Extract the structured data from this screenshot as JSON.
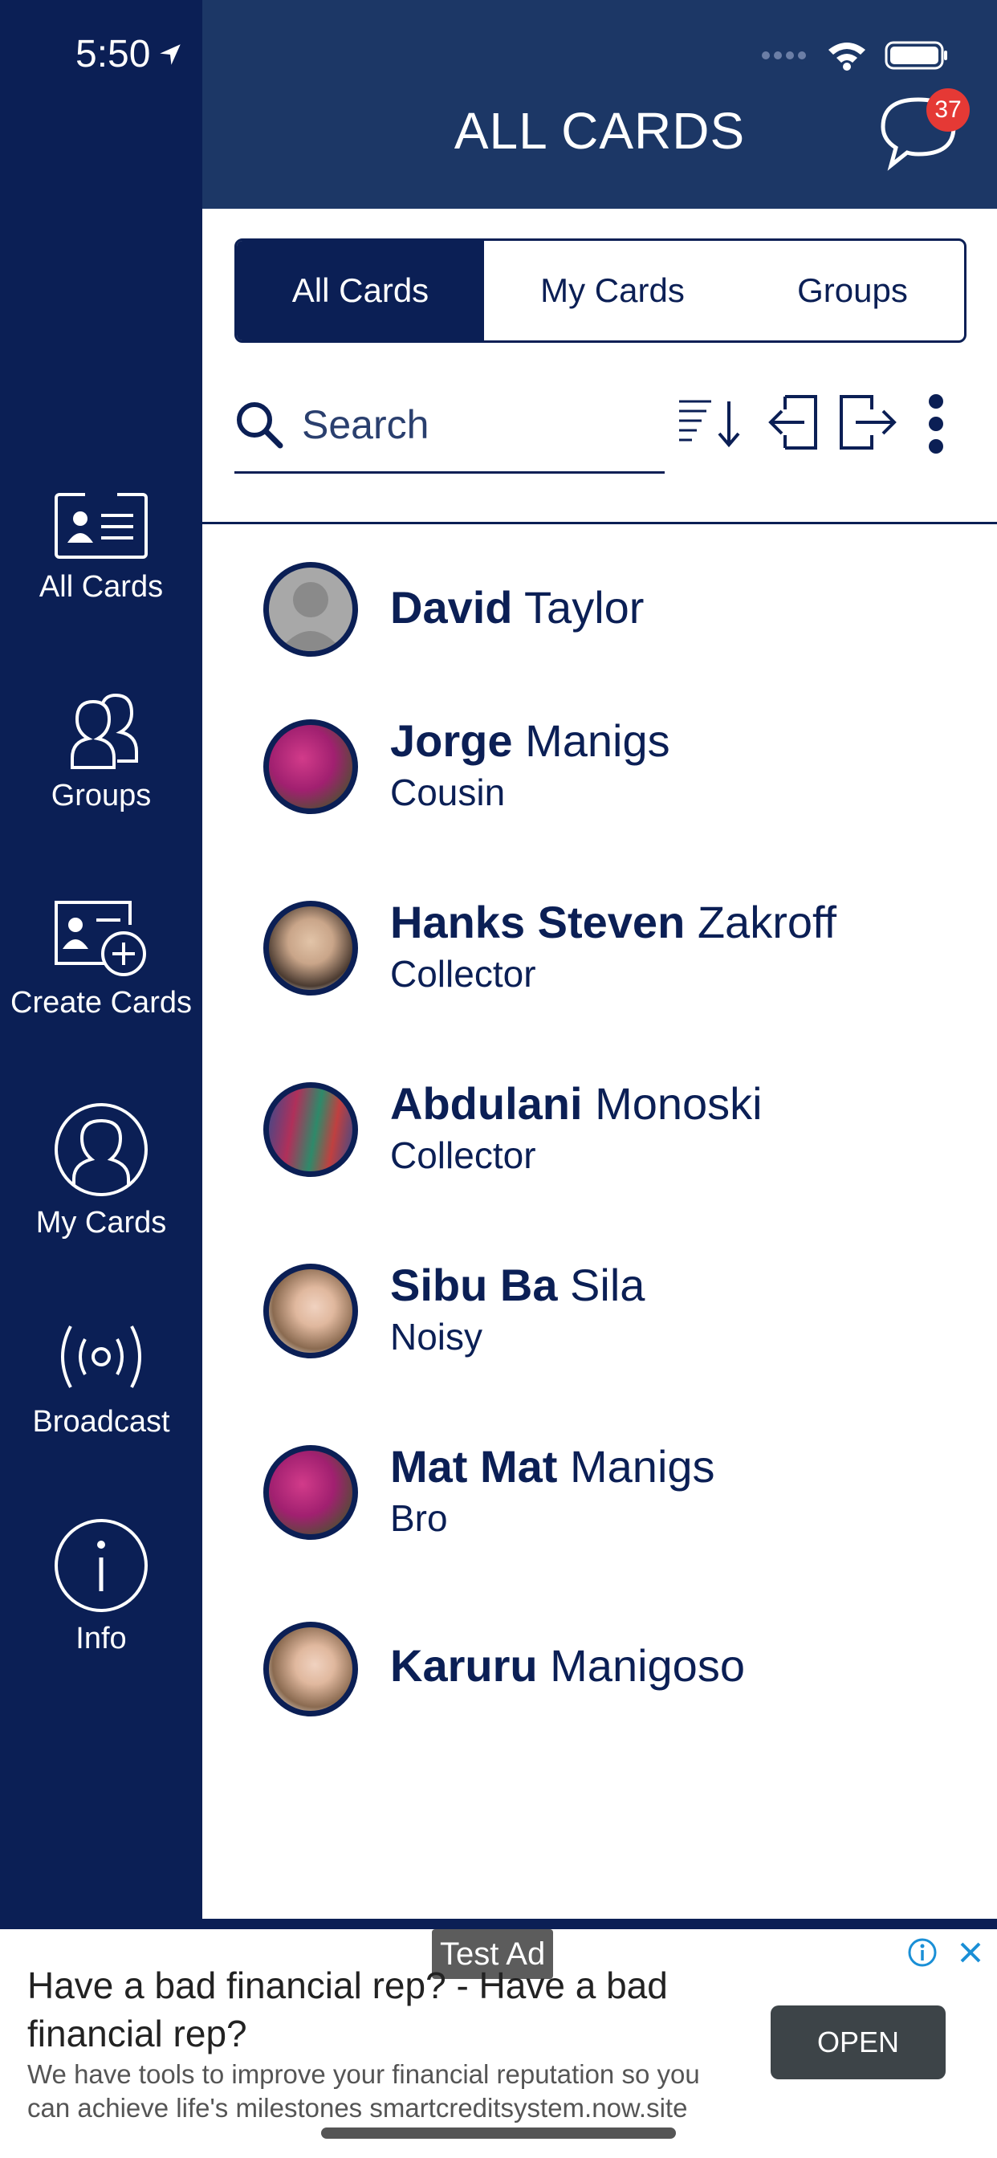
{
  "status_bar": {
    "time": "5:50"
  },
  "header": {
    "title": "ALL CARDS",
    "chat_badge": "37"
  },
  "sidebar": {
    "items": [
      {
        "label": "All Cards"
      },
      {
        "label": "Groups"
      },
      {
        "label": "Create Cards"
      },
      {
        "label": "My Cards"
      },
      {
        "label": "Broadcast"
      },
      {
        "label": "Info"
      }
    ]
  },
  "tabs": [
    {
      "label": "All Cards",
      "active": true
    },
    {
      "label": "My Cards",
      "active": false
    },
    {
      "label": "Groups",
      "active": false
    }
  ],
  "search": {
    "placeholder": "Search"
  },
  "contacts": [
    {
      "first": "David",
      "last": "Taylor",
      "subtitle": ""
    },
    {
      "first": "Jorge",
      "last": "Manigs",
      "subtitle": "Cousin"
    },
    {
      "first": "Hanks Steven",
      "last": "Zakroff",
      "subtitle": "Collector"
    },
    {
      "first": "Abdulani",
      "last": "Monoski",
      "subtitle": "Collector"
    },
    {
      "first": "Sibu Ba",
      "last": "Sila",
      "subtitle": "Noisy"
    },
    {
      "first": "Mat Mat",
      "last": "Manigs",
      "subtitle": "Bro"
    },
    {
      "first": "Karuru",
      "last": "Manigoso",
      "subtitle": ""
    }
  ],
  "ad": {
    "tag": "Test Ad",
    "title": "Have a bad financial rep? - Have a bad financial rep?",
    "description": "We have tools to improve your financial reputation so you can achieve life's milestones smartcreditsystem.now.site",
    "button": "OPEN"
  },
  "colors": {
    "navy": "#0b1f55",
    "header": "#1c3766",
    "badge": "#e53935"
  }
}
